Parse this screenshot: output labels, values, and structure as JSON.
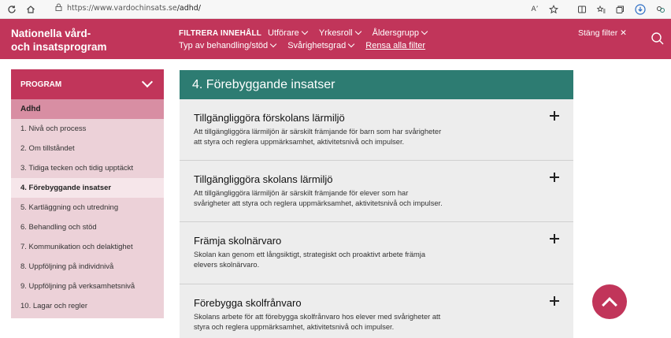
{
  "browser": {
    "url_prefix": "https://www.vardochinsats.se",
    "url_path": "/adhd/",
    "reader_label": "Aʼ"
  },
  "header": {
    "brand_line1": "Nationella vård-",
    "brand_line2": "och insatsprogram",
    "filter_title": "FILTRERA INNEHÅLL",
    "filters_row1": [
      "Utförare",
      "Yrkesroll",
      "Åldersgrupp"
    ],
    "filters_row2": [
      "Typ av behandling/stöd",
      "Svårighetsgrad"
    ],
    "clear_all": "Rensa alla filter",
    "close_filter": "Stäng filter ✕"
  },
  "sidebar": {
    "title": "PROGRAM",
    "program": "Adhd",
    "items": [
      "1. Nivå och process",
      "2. Om tillståndet",
      "3. Tidiga tecken och tidig upptäckt",
      "4. Förebyggande insatser",
      "5. Kartläggning och utredning",
      "6. Behandling och stöd",
      "7. Kommunikation och delaktighet",
      "8. Uppföljning på individnivå",
      "9. Uppföljning på verksamhetsnivå",
      "10. Lagar och regler"
    ],
    "active_index": 3
  },
  "main": {
    "section_title": "4. Förebyggande insatser",
    "cards": [
      {
        "title": "Tillgängliggöra förskolans lärmiljö",
        "text_line1": "Att tillgängliggöra lärmiljön är särskilt främjande för barn som har svårigheter",
        "text_line2": "att styra och reglera uppmärksamhet, aktivitetsnivå och impulser."
      },
      {
        "title": "Tillgängliggöra skolans lärmiljö",
        "text_line1": "Att tillgängliggöra lärmiljön är särskilt främjande för elever som har",
        "text_line2": "svårigheter att styra och reglera uppmärksamhet, aktivitetsnivå och impulser."
      },
      {
        "title": "Främja skolnärvaro",
        "text_line1": "Skolan kan genom ett långsiktigt, strategiskt och proaktivt arbete främja",
        "text_line2": "elevers skolnärvaro."
      },
      {
        "title": "Förebygga skolfrånvaro",
        "text_line1": "Skolans arbete för att förebygga skolfrånvaro hos elever med svårigheter att",
        "text_line2": "styra och reglera uppmärksamhet, aktivitetsnivå och impulser."
      }
    ]
  },
  "colors": {
    "brand": "#c1355a",
    "section_header": "#2d7c72",
    "sidebar_bg": "#ecd1d8",
    "card_bg": "#ededed"
  },
  "icons": {
    "back": "arrow-left-icon",
    "home": "home-icon",
    "lock": "lock-icon",
    "search": "search-icon",
    "plus": "plus-icon",
    "back_to_top": "chevron-up-icon"
  }
}
